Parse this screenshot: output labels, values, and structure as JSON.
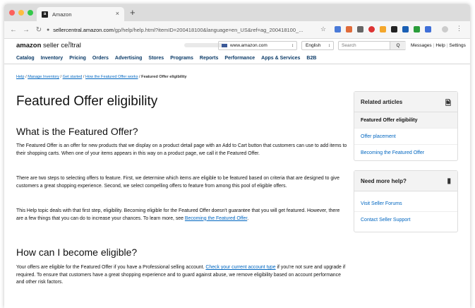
{
  "browser": {
    "tab_title": "Amazon",
    "favicon_letter": "a",
    "close_glyph": "×",
    "new_tab_glyph": "+",
    "url_host": "sellercentral.amazon.com",
    "url_path": "/gp/help/help.html?itemID=200418100&language=en_US&ref=ag_200418100_...",
    "icons": [
      "back-icon",
      "forward-icon",
      "reload-icon",
      "lock-icon",
      "star-icon"
    ]
  },
  "header": {
    "logo_bold": "amazon",
    "logo_light": " seller central",
    "marketplace": "www.amazon.com",
    "language": "English",
    "search_placeholder": "Search",
    "search_button": "Q",
    "links": [
      "Messages",
      "Help",
      "Settings"
    ]
  },
  "nav": [
    "Catalog",
    "Inventory",
    "Pricing",
    "Orders",
    "Advertising",
    "Stores",
    "Programs",
    "Reports",
    "Performance",
    "Apps & Services",
    "B2B"
  ],
  "breadcrumb": {
    "items": [
      "Help",
      "Manage Inventory",
      "Get started",
      "How the Featured Offer works"
    ],
    "current": "Featured Offer eligibility",
    "separator": " / "
  },
  "main": {
    "title": "Featured Offer eligibility",
    "section1_heading": "What is the Featured Offer?",
    "p1": "The Featured Offer is an offer for new products that we display on a product detail page with an Add to Cart button that customers can use to add items to their shopping carts. When one of your items appears in this way on a product page, we call it the Featured Offer.",
    "p2": "There are two steps to selecting offers to feature. First, we determine which items are eligible to be featured based on criteria that are designed to give customers a great shopping experience. Second, we select compelling offers to feature from among this pool of eligible offers.",
    "p3_text": "This Help topic deals with that first step, eligibility. Becoming eligible for the Featured Offer doesn't guarantee that you will get featured. However, there are a few things that you can do to increase your chances. To learn more, see ",
    "p3_link": "Becoming the Featured Offer",
    "p3_end": ".",
    "section2_heading": "How can I become eligible?",
    "p4_text": "Your offers are eligible for the Featured Offer if you have a Professional selling account. ",
    "p4_link": "Check your current account type",
    "p4_end": " if you're not sure and upgrade if required. To ensure that customers have a great shopping experience and to guard against abuse, we remove eligibility based on account performance and other risk factors."
  },
  "related": {
    "title": "Related articles",
    "items": [
      "Featured Offer eligibility",
      "Offer placement",
      "Becoming the Featured Offer"
    ]
  },
  "help": {
    "title": "Need more help?",
    "items": [
      "Visit Seller Forums",
      "Contact Seller Support"
    ]
  },
  "colors": {
    "link": "#0066c0",
    "nav": "#0a3a67"
  }
}
